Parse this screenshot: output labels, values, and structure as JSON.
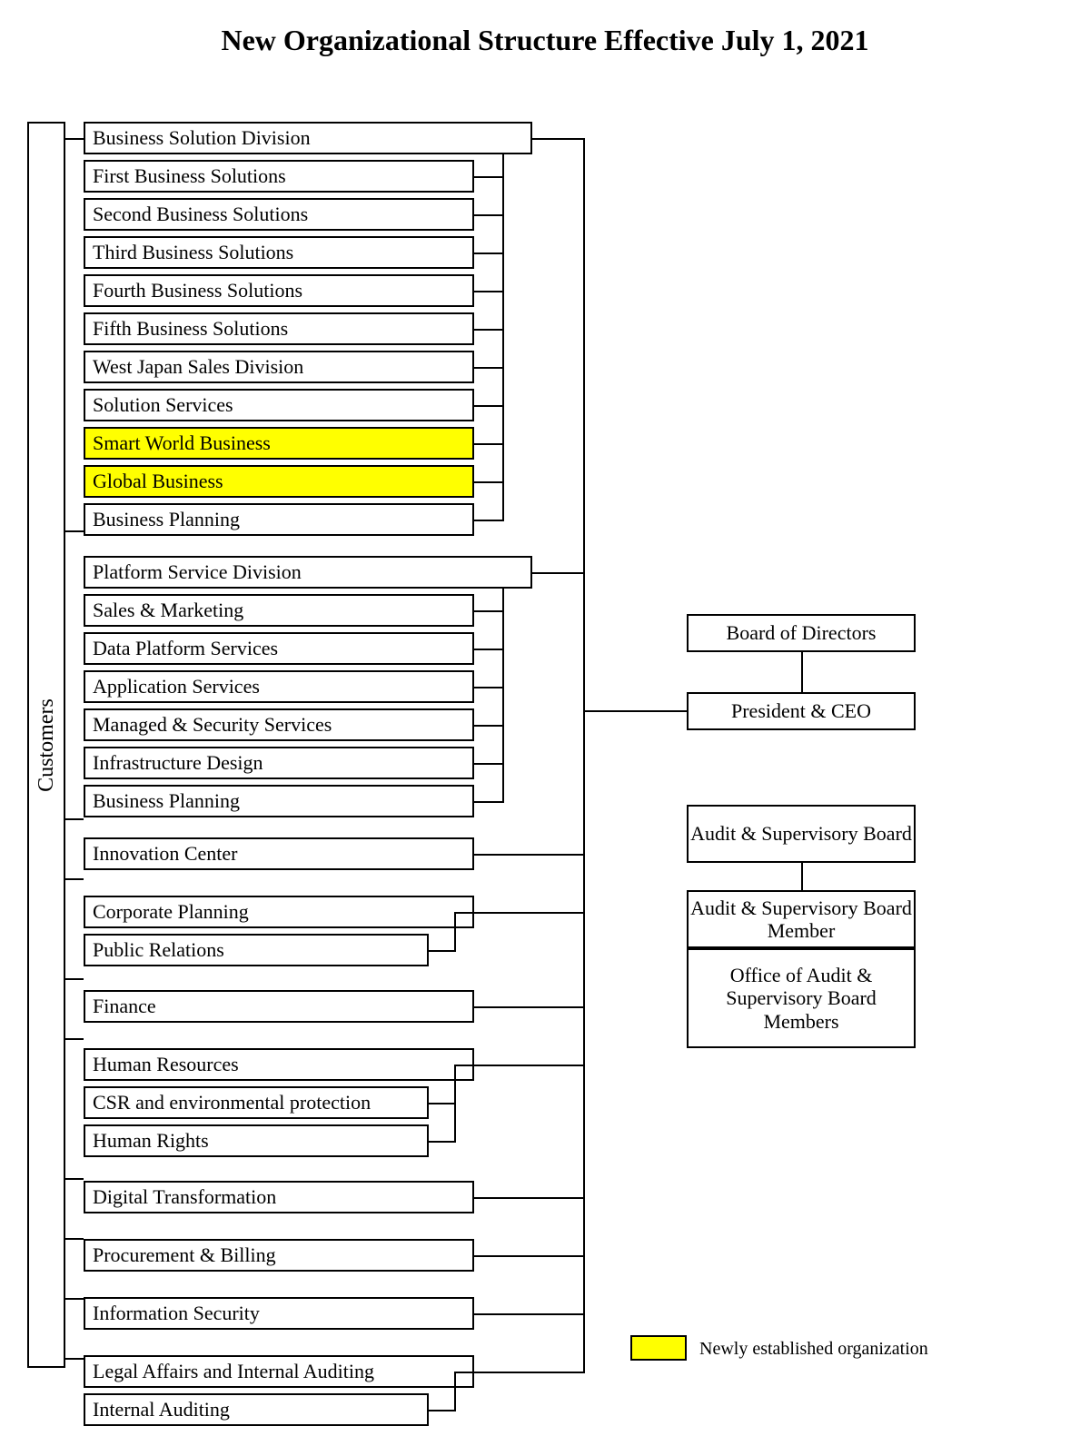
{
  "title": "New Organizational Structure Effective July 1, 2021",
  "customers_label": "Customers",
  "bsd": "Business Solution Division",
  "bsd_items": {
    "0": "First Business Solutions",
    "1": "Second Business Solutions",
    "2": "Third Business Solutions",
    "3": "Fourth Business Solutions",
    "4": "Fifth Business Solutions",
    "5": "West Japan Sales Division",
    "6": "Solution Services",
    "7": "Smart World Business",
    "8": "Global Business",
    "9": "Business Planning"
  },
  "psd": "Platform Service Division",
  "psd_items": {
    "0": "Sales & Marketing",
    "1": "Data Platform Services",
    "2": "Application Services",
    "3": "Managed & Security Services",
    "4": "Infrastructure Design",
    "5": "Business Planning"
  },
  "innovation": "Innovation Center",
  "corp": "Corporate Planning",
  "corp_items": {
    "0": "Public Relations"
  },
  "finance": "Finance",
  "hr": "Human Resources",
  "hr_items": {
    "0": "CSR and environmental protection",
    "1": "Human Rights"
  },
  "dx": "Digital Transformation",
  "procbill": "Procurement & Billing",
  "infosec": "Information Security",
  "legal": "Legal Affairs and Internal Auditing",
  "legal_items": {
    "0": "Internal Auditing"
  },
  "board": "Board of Directors",
  "ceo": "President & CEO",
  "asb": "Audit & Supervisory Board",
  "asbm": "Audit & Supervisory Board Member",
  "office_asbm": "Office of Audit & Supervisory Board Members",
  "legend": "Newly established organization"
}
